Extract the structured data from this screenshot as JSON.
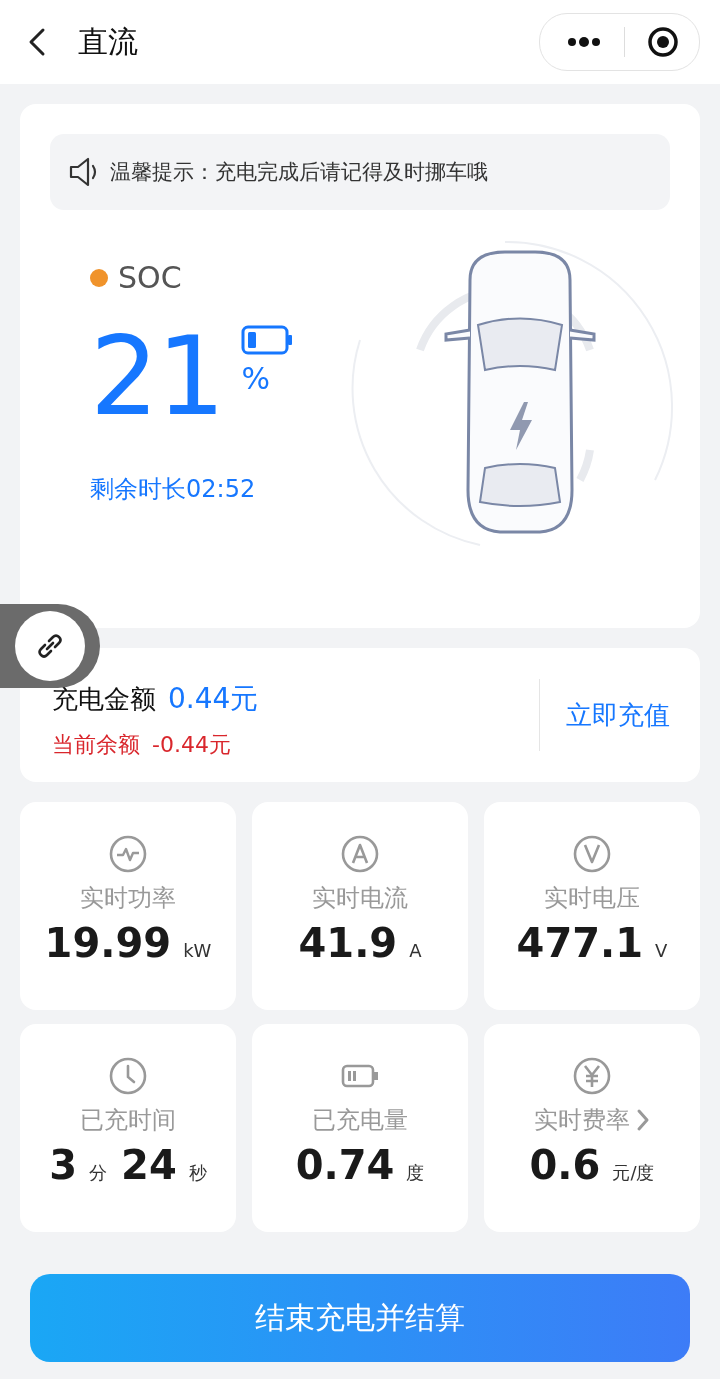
{
  "header": {
    "title": "直流"
  },
  "notice": "温馨提示：充电完成后请记得及时挪车哦",
  "soc": {
    "label": "SOC",
    "color": "#f0932b",
    "value": "21",
    "unit": "%",
    "remaining": "剩余时长02:52"
  },
  "money": {
    "amount_label": "充电金额",
    "amount": "0.44元",
    "balance_label": "当前余额",
    "balance": "-0.44元",
    "recharge": "立即充值"
  },
  "stats": [
    {
      "label": "实时功率",
      "link": false,
      "parts": [
        {
          "value": "19.99",
          "unit": "kW"
        }
      ]
    },
    {
      "label": "实时电流",
      "link": false,
      "parts": [
        {
          "value": "41.9",
          "unit": "A"
        }
      ]
    },
    {
      "label": "实时电压",
      "link": false,
      "parts": [
        {
          "value": "477.1",
          "unit": "V"
        }
      ]
    },
    {
      "label": "已充时间",
      "link": false,
      "parts": [
        {
          "value": "3",
          "unit": "分"
        },
        {
          "value": "24",
          "unit": "秒"
        }
      ]
    },
    {
      "label": "已充电量",
      "link": false,
      "parts": [
        {
          "value": "0.74",
          "unit": "度"
        }
      ]
    },
    {
      "label": "实时费率",
      "link": true,
      "parts": [
        {
          "value": "0.6",
          "unit": "元/度"
        }
      ]
    }
  ],
  "action": "结束充电并结算"
}
